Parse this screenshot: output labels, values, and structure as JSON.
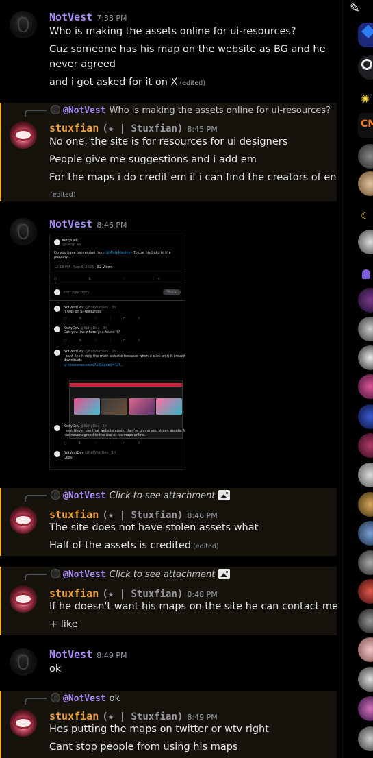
{
  "messages": [
    {
      "author": "NotVest",
      "time": "7:38 PM",
      "lines": [
        "Who is making the assets online for ui-resources?",
        "Cuz someone has his map on the website as BG and he",
        "never agreed",
        "and i got asked  for it on X"
      ],
      "edited": "(edited)"
    },
    {
      "reply_to": "@NotVest",
      "reply_text": "Who is making the assets online for ui-resources?",
      "author": "stuxfian",
      "tag": "(★ | Stuxfian)",
      "time": "8:45 PM",
      "lines": [
        "No one, the site is for resources for ui designers",
        "People give me suggestions and i add em",
        "For the maps i do credit em if i can find the creators of en"
      ],
      "edited": "(edited)"
    },
    {
      "author": "NotVest",
      "time": "8:46 PM",
      "attachment": {
        "tweet_author": "KettyDev",
        "tweet_handle": "@KettyDev",
        "tweet_text_a": "Do you have permission from",
        "tweet_mention": "@MistyMauleyn",
        "tweet_text_b": "To use his build in the",
        "tweet_text_c": "preview!?",
        "tweet_meta": "12:18 PM · Sep 3, 2025 ·",
        "tweet_views": "82 Views",
        "reply_placeholder": "Post your reply",
        "reply_button": "Reply",
        "replies": [
          {
            "author": "NotVestDev",
            "handle": "@NotVestDev · 3h",
            "text": "It was on ui-resources"
          },
          {
            "author": "KettyDev",
            "handle": "@KettyDev · 3h",
            "text": "Can you link where you found it?"
          },
          {
            "author": "NotVestDev",
            "handle": "@NotVestDev · 2h",
            "text": "I cant link it only the main website because when u click on it it instant",
            "text2": "downloads",
            "link": "ui-resources.com/?uiCapoed=1/?..."
          },
          {
            "author": "KettyDev",
            "handle": "@KettyDev · 1h",
            "text": "I see. Never use that website again, they're giving you stolen assets. Misty",
            "text2": "has never agreed to the use of his maps online."
          },
          {
            "author": "NotVestDev",
            "handle": "@NotVestDev · 1h",
            "text": "Okay"
          }
        ]
      }
    },
    {
      "reply_to": "@NotVest",
      "reply_text": "Click to see attachment",
      "author": "stuxfian",
      "tag": "(★ | Stuxfian)",
      "time": "8:46 PM",
      "lines": [
        "The site does not have stolen assets what",
        "Half of the assets is credited"
      ],
      "edited": "(edited)"
    },
    {
      "reply_to": "@NotVest",
      "reply_text": "Click to see attachment",
      "author": "stuxfian",
      "tag": "(★ | Stuxfian)",
      "time": "8:48 PM",
      "lines": [
        "If he doesn't want his maps on the site he can contact me",
        "+ like"
      ]
    },
    {
      "author": "NotVest",
      "time": "8:49 PM",
      "lines": [
        "ok"
      ]
    },
    {
      "reply_to": "@NotVest",
      "reply_text": "ok",
      "author": "stuxfian",
      "tag": "(★ | Stuxfian)",
      "time": "8:49 PM",
      "lines": [
        "Hes putting the maps on twitter or wtv right",
        "Cant stop people from using his maps"
      ]
    }
  ],
  "colors": {
    "notvest_name": "#a98bf5",
    "stuxfian_name": "#f0a23c",
    "highlight_bg": "#16120c",
    "highlight_bar": "#f0b232"
  },
  "server_rail": {
    "icons": [
      "pen-icon",
      "blue-diamond-server-icon",
      "ring-server-icon",
      "sun-server-icon",
      "cm-server-icon",
      "server-avatar",
      "server-avatar",
      "moon-server-icon",
      "server-avatar",
      "purple-user-server-icon",
      "server-avatar",
      "server-avatar",
      "server-avatar",
      "server-avatar",
      "server-avatar",
      "server-avatar",
      "server-avatar",
      "server-avatar",
      "server-avatar",
      "server-avatar",
      "server-avatar",
      "server-avatar",
      "server-avatar",
      "server-avatar",
      "server-avatar",
      "server-avatar"
    ],
    "cm_label": "CM"
  }
}
